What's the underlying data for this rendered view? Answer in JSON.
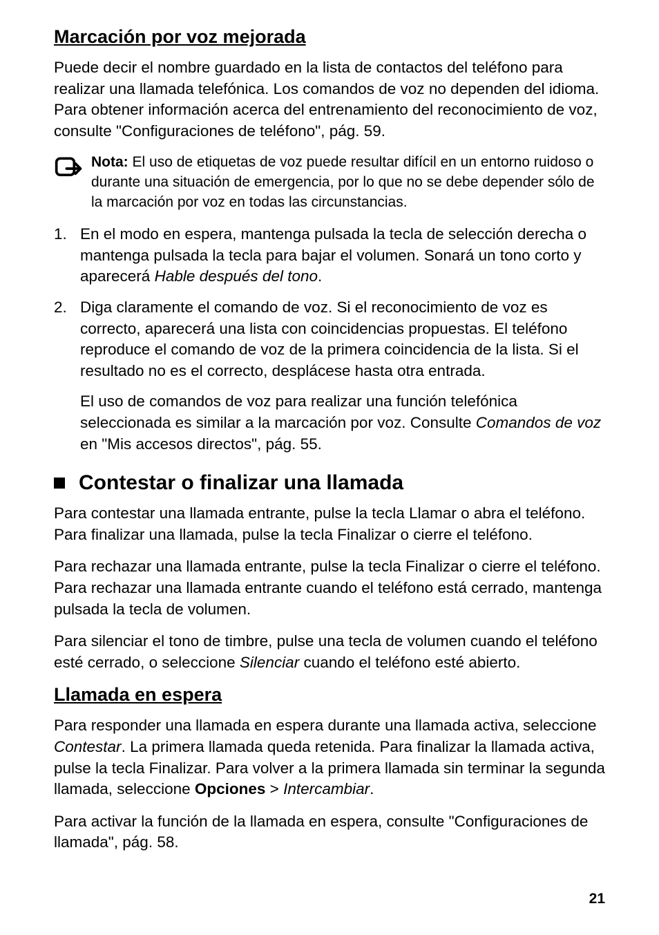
{
  "section1": {
    "heading": "Marcación por voz mejorada",
    "p1a": "Puede decir el nombre guardado en la lista de contactos del teléfono para realizar una llamada telefónica. Los comandos de voz no dependen del idioma. Para obtener información acerca del entrenamiento del reconocimiento de voz, consulte \"Configuraciones de teléfono\", pág. 59.",
    "note_label": "Nota:",
    "note_body": " El uso de etiquetas de voz puede resultar difícil en un entorno ruidoso o durante una situación de emergencia, por lo que no se debe depender sólo de la marcación por voz en todas las circunstancias.",
    "step1a": "En el modo en espera, mantenga pulsada la tecla de selección derecha o mantenga pulsada la tecla para bajar el volumen. Sonará un tono corto y aparecerá ",
    "step1i": "Hable después del tono",
    "step1b": ".",
    "step2a": "Diga claramente el comando de voz. Si el reconocimiento de voz es correcto, aparecerá una lista con coincidencias propuestas. El teléfono reproduce el comando de voz de la primera coincidencia de la lista. Si el resultado no es el correcto, desplácese hasta otra entrada.",
    "step2sub_a": "El uso de comandos de voz para realizar una función telefónica seleccionada es similar a la marcación por voz. Consulte ",
    "step2sub_i": "Comandos de voz",
    "step2sub_b": " en \"Mis accesos directos\", pág. 55."
  },
  "section2": {
    "heading": "Contestar o finalizar una llamada",
    "p1": "Para contestar una llamada entrante, pulse la tecla Llamar o abra el teléfono. Para finalizar una llamada, pulse la tecla Finalizar o cierre el teléfono.",
    "p2": "Para rechazar una llamada entrante, pulse la tecla Finalizar o cierre el teléfono. Para rechazar una llamada entrante cuando el teléfono está cerrado, mantenga pulsada la tecla de volumen.",
    "p3a": "Para silenciar el tono de timbre, pulse una tecla de volumen cuando el teléfono esté cerrado, o seleccione ",
    "p3i": "Silenciar",
    "p3b": " cuando el teléfono esté abierto."
  },
  "section3": {
    "heading": "Llamada en espera",
    "p1a": "Para responder una llamada en espera durante una llamada activa, seleccione ",
    "p1i1": "Contestar",
    "p1b": ". La primera llamada queda retenida. Para finalizar la llamada activa, pulse la tecla Finalizar. Para volver a la primera llamada sin terminar la segunda llamada, seleccione ",
    "p1bold": "Opciones",
    "p1c": " > ",
    "p1i2": "Intercambiar",
    "p1d": ".",
    "p2": "Para activar la función de la llamada en espera, consulte \"Configuraciones de llamada\", pág. 58."
  },
  "pagenum": "21"
}
